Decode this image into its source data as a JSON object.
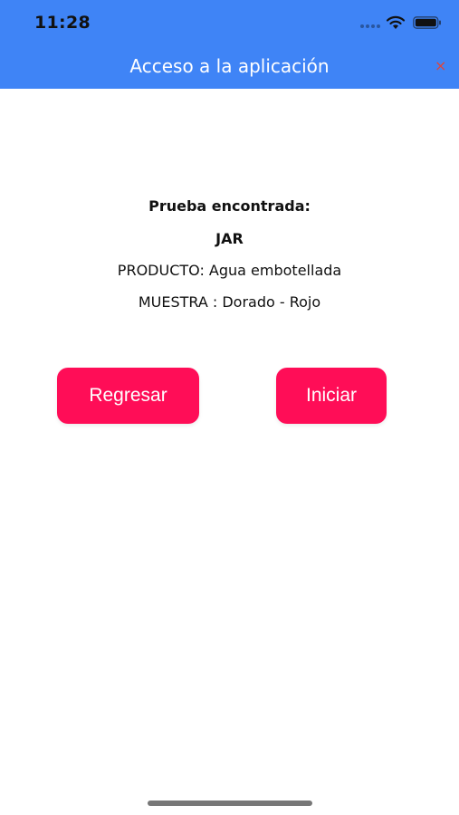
{
  "status_bar": {
    "time": "11:28",
    "icons": [
      "signal-dots-icon",
      "wifi-icon",
      "battery-icon"
    ]
  },
  "header": {
    "title": "Acceso a la aplicación",
    "close_icon": "×",
    "background_color": "#3f84f6",
    "close_color": "#e0453a"
  },
  "test_info": {
    "heading": "Prueba encontrada:",
    "code": "JAR",
    "product": "PRODUCTO: Agua embotellada",
    "sample": "MUESTRA : Dorado - Rojo"
  },
  "actions": {
    "back_label": "Regresar",
    "start_label": "Iniciar",
    "button_color": "#ff0d57"
  }
}
